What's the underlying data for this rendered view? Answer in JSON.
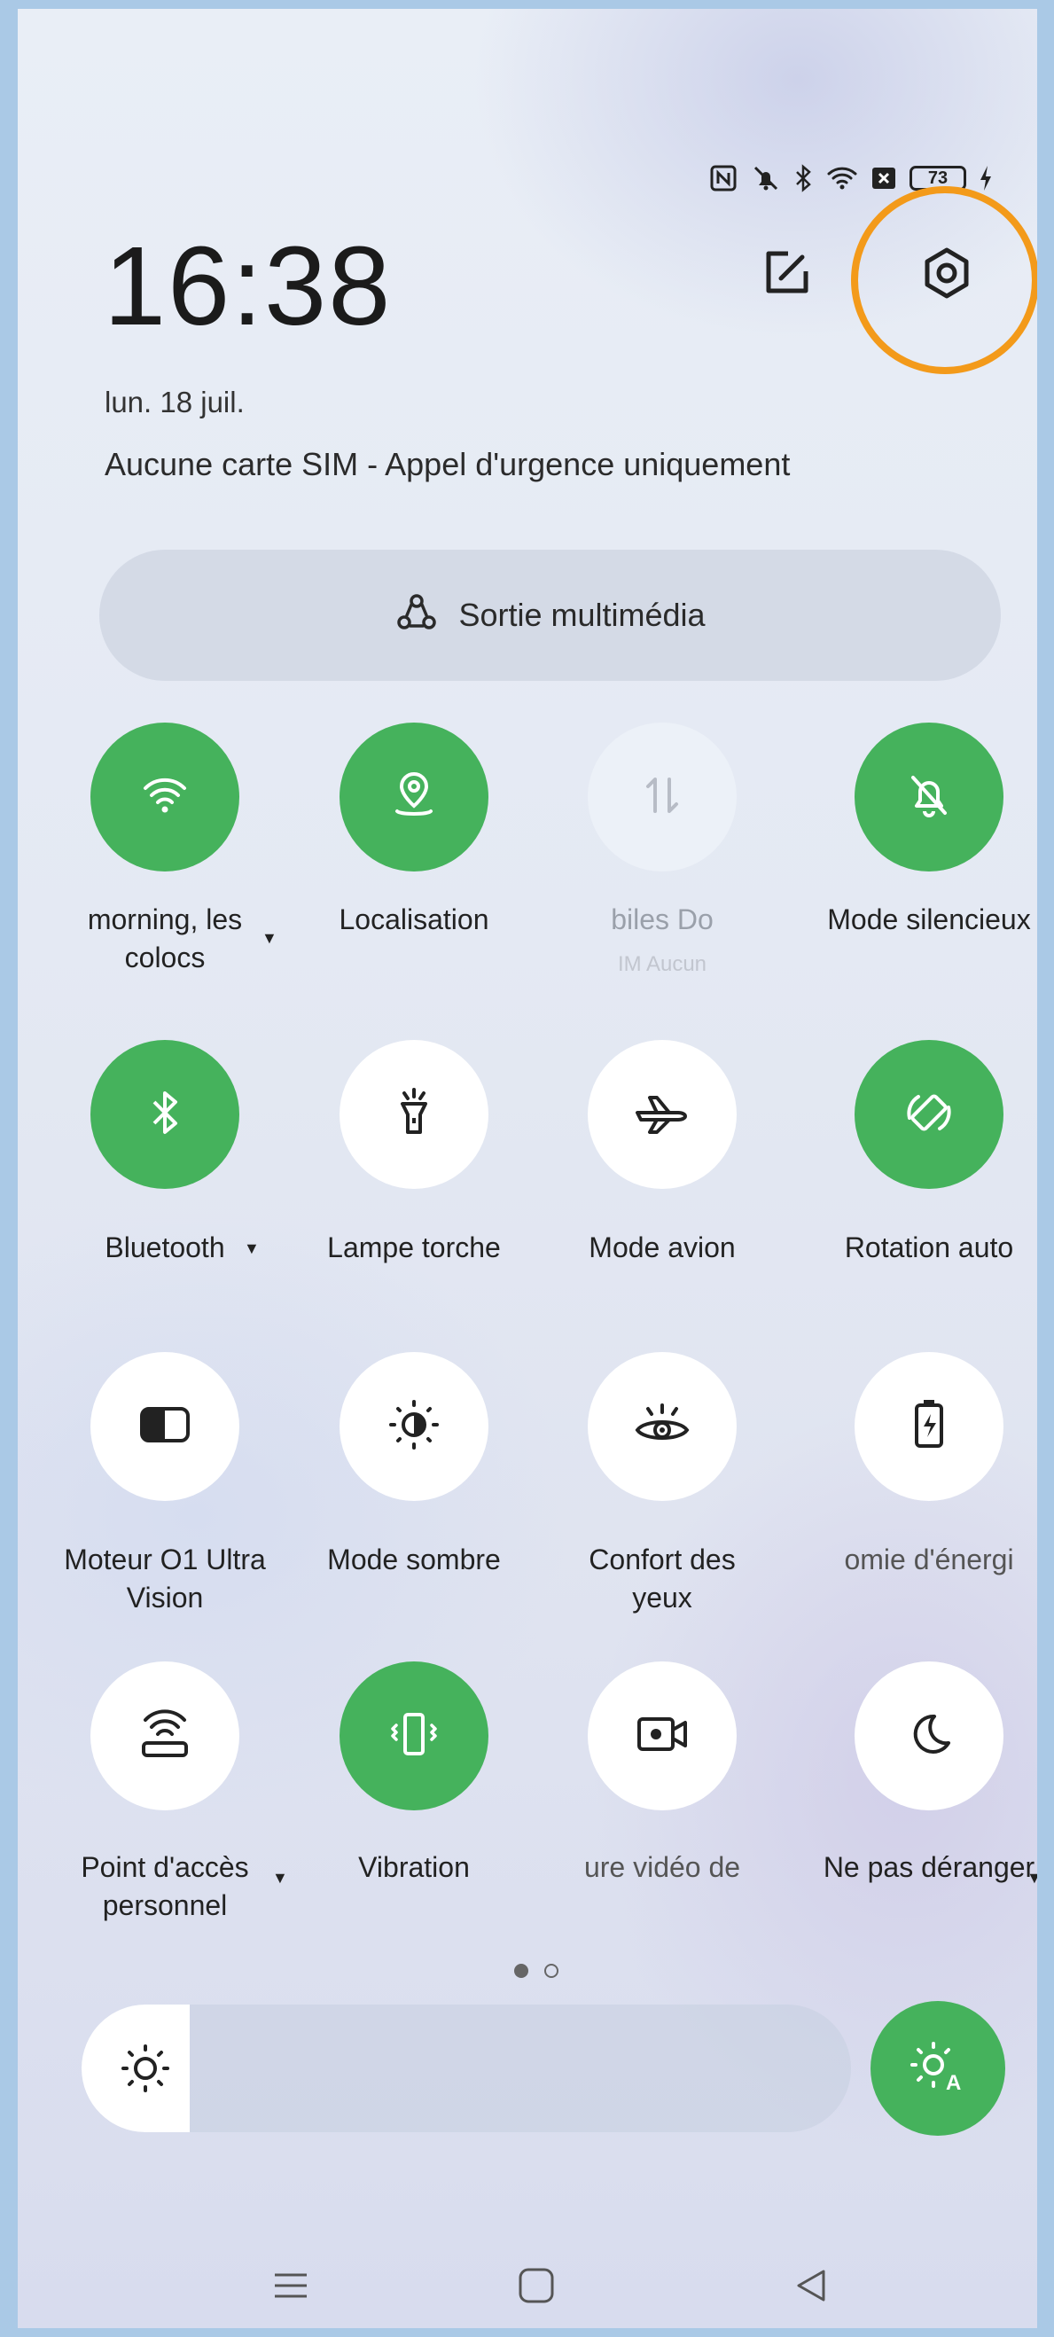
{
  "status_bar": {
    "icons": [
      "nfc-icon",
      "mute-icon",
      "bluetooth-icon",
      "wifi-icon",
      "no-sim-icon"
    ],
    "battery": "73"
  },
  "header": {
    "time": "16:38",
    "date": "lun. 18 juil.",
    "sim_status": "Aucune carte SIM - Appel d'urgence uniquement",
    "edit_icon": "edit-icon",
    "settings_icon": "settings-icon",
    "highlight_color": "#f39a1a"
  },
  "media_output": {
    "label": "Sortie multimédia"
  },
  "tiles": [
    {
      "label": "morning, les colocs",
      "state": "on",
      "icon": "wifi-icon"
    },
    {
      "label": "Localisation",
      "state": "on",
      "icon": "location-icon"
    },
    {
      "label": "biles   Do",
      "sub": "IM    Aucun",
      "state": "dim",
      "icon": "mobile-data-icon"
    },
    {
      "label": "Mode silencieux",
      "state": "on",
      "icon": "bell-off-icon"
    },
    {
      "label": "Bluetooth",
      "state": "on",
      "icon": "bluetooth-icon"
    },
    {
      "label": "Lampe torche",
      "state": "off",
      "icon": "flashlight-icon"
    },
    {
      "label": "Mode avion",
      "state": "off",
      "icon": "airplane-icon"
    },
    {
      "label": "Rotation auto",
      "state": "on",
      "icon": "rotation-icon"
    },
    {
      "label": "Moteur O1 Ultra Vision",
      "state": "off",
      "icon": "vision-engine-icon"
    },
    {
      "label": "Mode sombre",
      "state": "off",
      "icon": "dark-mode-icon"
    },
    {
      "label": "Confort des yeux",
      "state": "off",
      "icon": "eye-comfort-icon"
    },
    {
      "label": "omie d'énergi",
      "state": "off",
      "icon": "battery-saver-icon"
    },
    {
      "label": "Point d'accès personnel",
      "state": "off",
      "icon": "hotspot-icon"
    },
    {
      "label": "Vibration",
      "state": "on",
      "icon": "vibration-icon"
    },
    {
      "label": "ure vidéo de",
      "state": "off",
      "icon": "screen-record-icon"
    },
    {
      "label": "Ne pas déranger",
      "state": "off",
      "icon": "moon-icon"
    }
  ],
  "page_indicator": {
    "current": 1,
    "total": 2
  },
  "brightness": {
    "level": 0.14,
    "auto_icon": "auto-brightness-icon"
  },
  "colors": {
    "accent_green": "#45b25c",
    "tile_off": "#ffffff"
  },
  "navigation": {
    "items": [
      "menu-icon",
      "home-icon",
      "back-icon"
    ]
  }
}
